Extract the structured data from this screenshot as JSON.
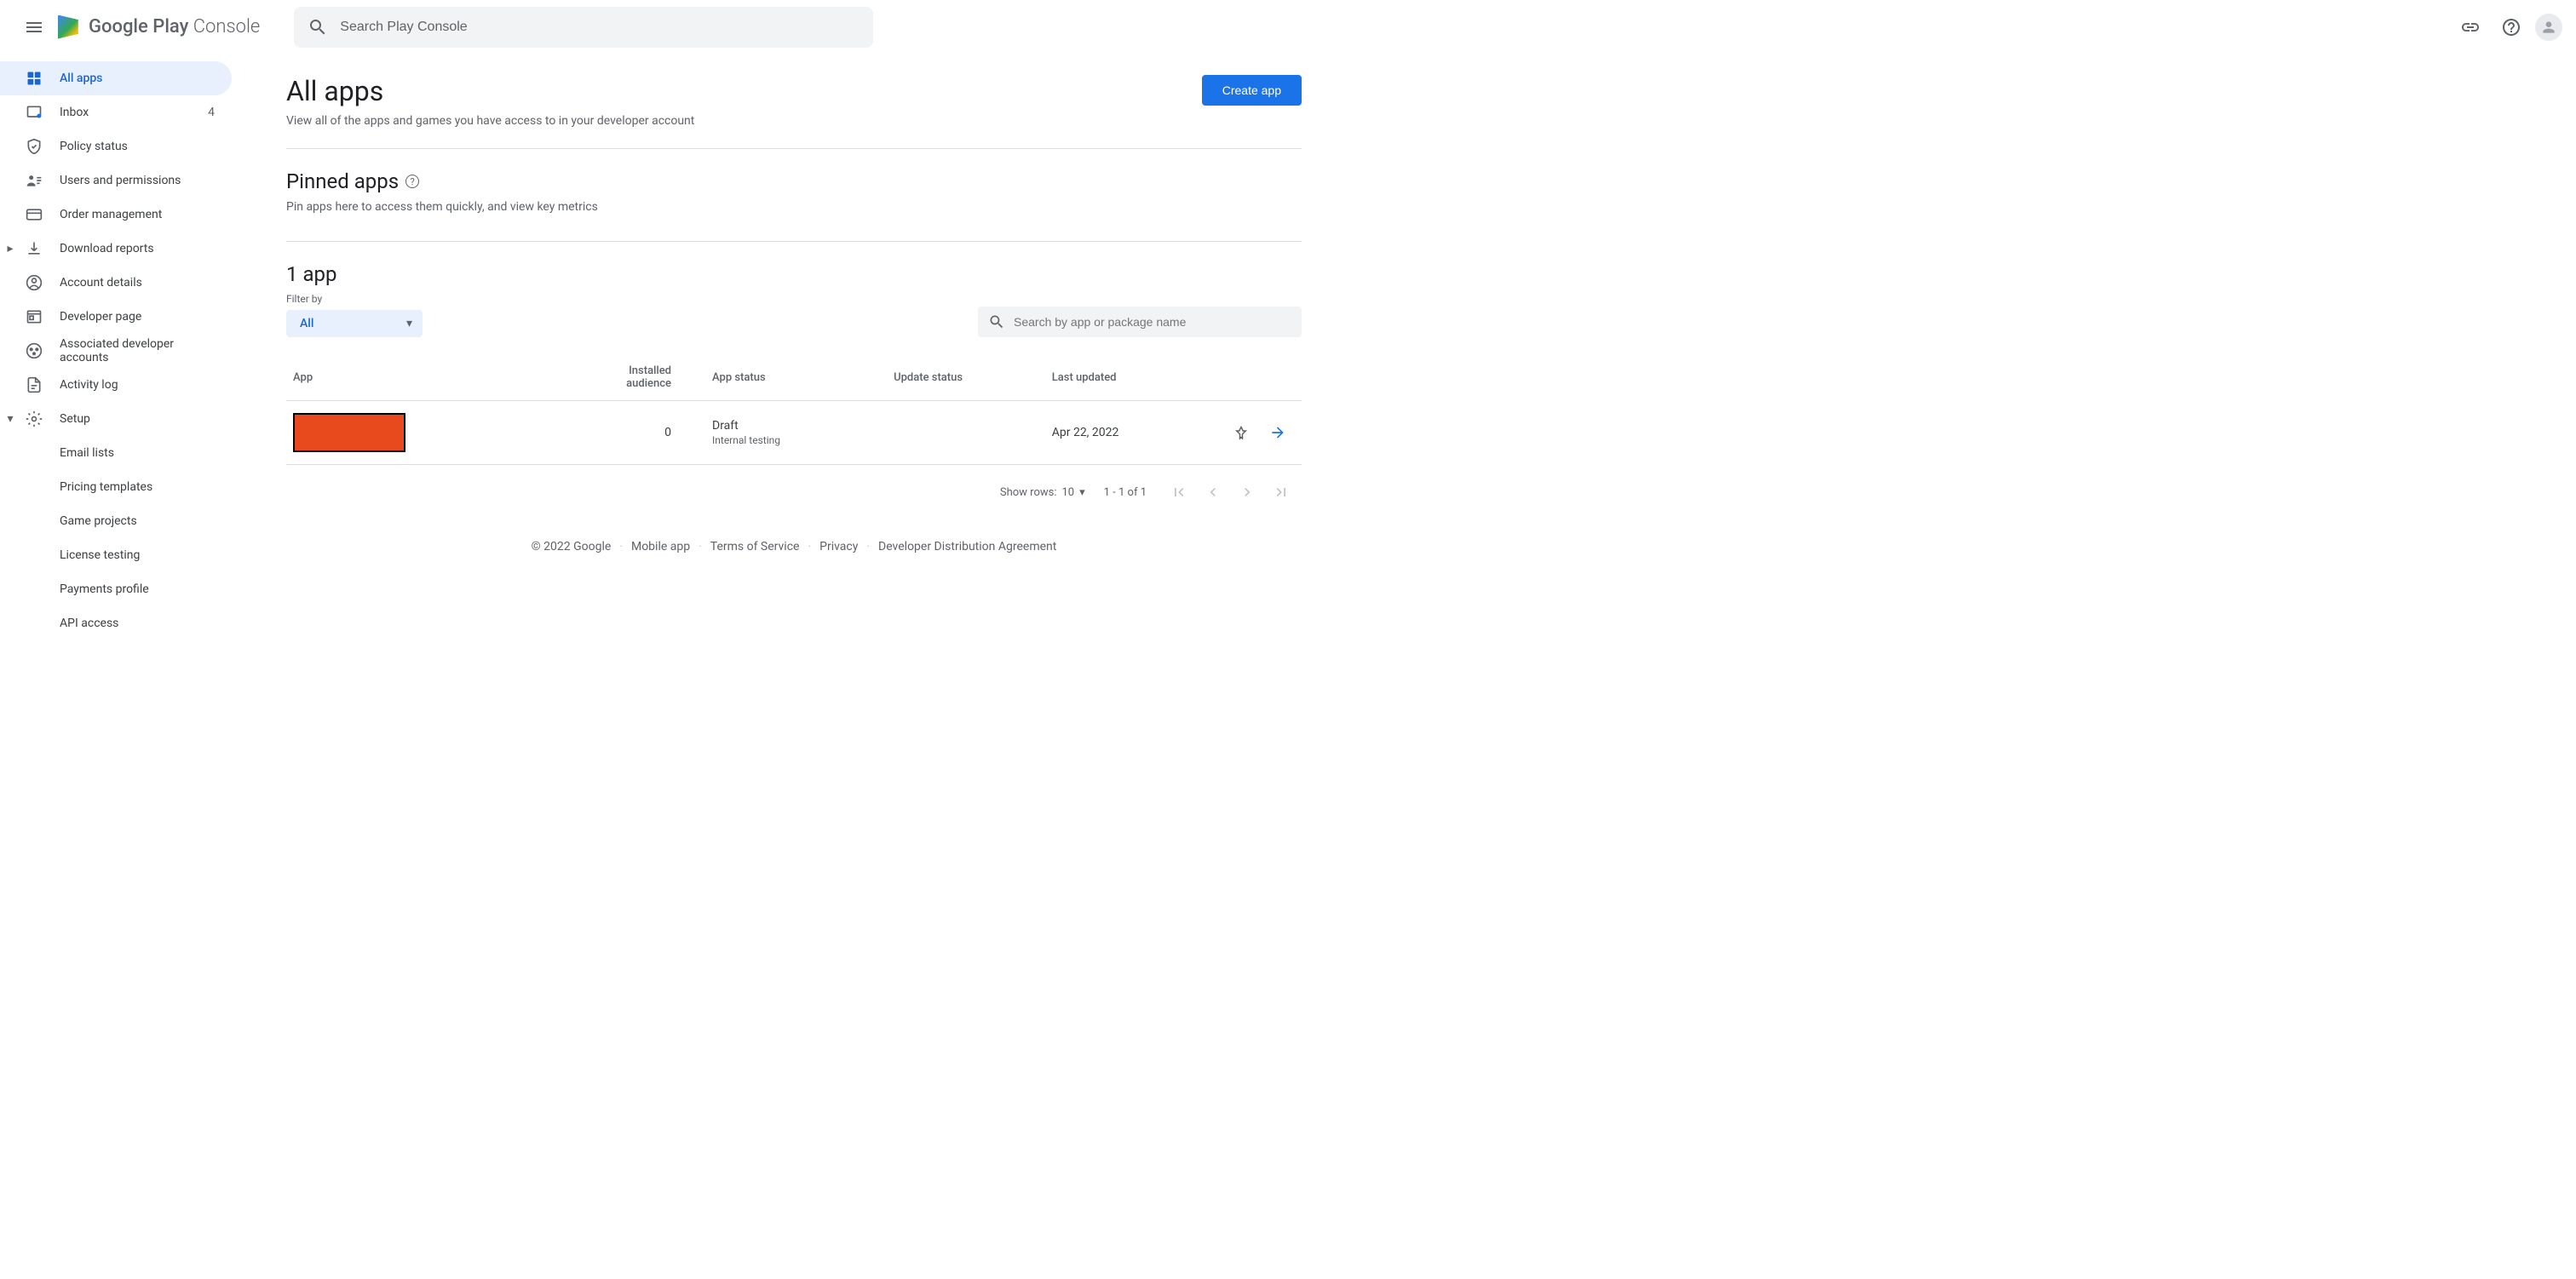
{
  "header": {
    "product_bold": "Google Play",
    "product_light": " Console",
    "search_placeholder": "Search Play Console"
  },
  "sidebar": {
    "items": [
      {
        "label": "All apps",
        "badge": ""
      },
      {
        "label": "Inbox",
        "badge": "4"
      },
      {
        "label": "Policy status",
        "badge": ""
      },
      {
        "label": "Users and permissions",
        "badge": ""
      },
      {
        "label": "Order management",
        "badge": ""
      },
      {
        "label": "Download reports",
        "badge": ""
      },
      {
        "label": "Account details",
        "badge": ""
      },
      {
        "label": "Developer page",
        "badge": ""
      },
      {
        "label": "Associated developer accounts",
        "badge": ""
      },
      {
        "label": "Activity log",
        "badge": ""
      },
      {
        "label": "Setup",
        "badge": ""
      }
    ],
    "setup_sub": [
      "Email lists",
      "Pricing templates",
      "Game projects",
      "License testing",
      "Payments profile",
      "API access"
    ]
  },
  "page": {
    "title": "All apps",
    "subtitle": "View all of the apps and games you have access to in your developer account",
    "create_button": "Create app",
    "pinned_title": "Pinned apps",
    "pinned_sub": "Pin apps here to access them quickly, and view key metrics",
    "app_count_title": "1 app",
    "filter_label": "Filter by",
    "filter_value": "All",
    "search_placeholder": "Search by app or package name"
  },
  "table": {
    "headers": [
      "App",
      "Installed audience",
      "App status",
      "Update status",
      "Last updated"
    ],
    "rows": [
      {
        "app": "",
        "installed": "0",
        "status": "Draft",
        "status_sub": "Internal testing",
        "update_status": "",
        "last_updated": "Apr 22, 2022"
      }
    ]
  },
  "pagination": {
    "show_rows_label": "Show rows:",
    "rows_per_page": "10",
    "range": "1 - 1 of 1"
  },
  "footer": {
    "copyright": "© 2022 Google",
    "links": [
      "Mobile app",
      "Terms of Service",
      "Privacy",
      "Developer Distribution Agreement"
    ]
  }
}
